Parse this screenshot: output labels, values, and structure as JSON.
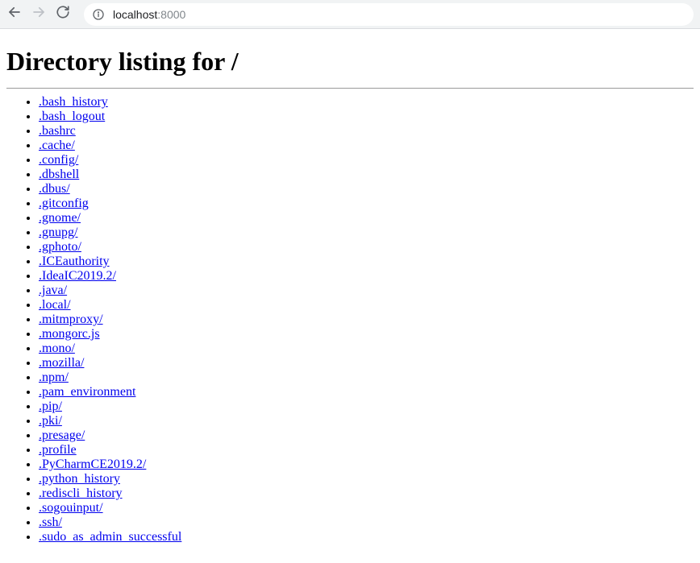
{
  "browser": {
    "url_host": "localhost",
    "url_port": ":8000"
  },
  "page": {
    "title": "Directory listing for /",
    "entries": [
      ".bash_history",
      ".bash_logout",
      ".bashrc",
      ".cache/",
      ".config/",
      ".dbshell",
      ".dbus/",
      ".gitconfig",
      ".gnome/",
      ".gnupg/",
      ".gphoto/",
      ".ICEauthority",
      ".IdeaIC2019.2/",
      ".java/",
      ".local/",
      ".mitmproxy/",
      ".mongorc.js",
      ".mono/",
      ".mozilla/",
      ".npm/",
      ".pam_environment",
      ".pip/",
      ".pki/",
      ".presage/",
      ".profile",
      ".PyCharmCE2019.2/",
      ".python_history",
      ".rediscli_history",
      ".sogouinput/",
      ".ssh/",
      ".sudo_as_admin_successful"
    ]
  }
}
